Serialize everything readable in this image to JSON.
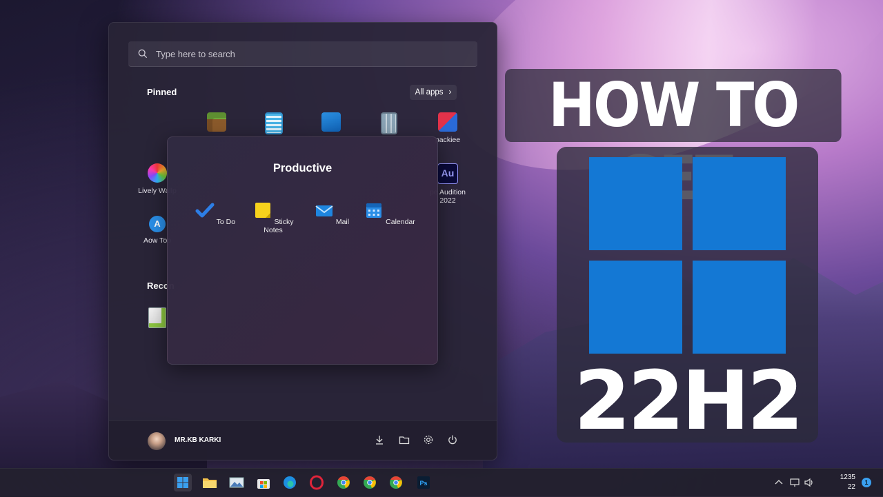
{
  "start_menu": {
    "search_placeholder": "Type here to search",
    "pinned_title": "Pinned",
    "all_apps_label": "All apps",
    "pinned_row1": [
      {
        "label": "",
        "icon": "minecraft-icon"
      },
      {
        "label": "",
        "icon": "notepad-icon"
      },
      {
        "label": "",
        "icon": "photos-icon"
      },
      {
        "label": "",
        "icon": "calculator-icon"
      },
      {
        "label": "packiee",
        "icon": "app-icon"
      }
    ],
    "pinned_row2_left": {
      "label": "Lively Wallp",
      "icon": "lively-wallpaper-icon"
    },
    "pinned_row2_right": {
      "label1": "pe Audition",
      "label2": "2022",
      "icon": "adobe-audition-icon",
      "icon_text": "Au"
    },
    "pinned_row3_left": {
      "label": "Aow Too",
      "icon": "aow-tool-icon"
    },
    "recommended_title": "Recon",
    "user": {
      "name": "MR.KB KARKI"
    }
  },
  "folder": {
    "title": "Productive",
    "apps": [
      {
        "label": "To Do",
        "icon": "todo-icon"
      },
      {
        "label": "Sticky Notes",
        "icon": "sticky-notes-icon"
      },
      {
        "label": "Mail",
        "icon": "mail-icon"
      },
      {
        "label": "Calendar",
        "icon": "calendar-icon"
      }
    ]
  },
  "promo": {
    "headline": "HOW TO GET",
    "version": "22H2"
  },
  "taskbar": {
    "clock_time": "1235",
    "clock_date": "22",
    "notification_count": "1"
  },
  "colors": {
    "windows_blue": "#1478d4",
    "accent": "#3aa0f0"
  }
}
